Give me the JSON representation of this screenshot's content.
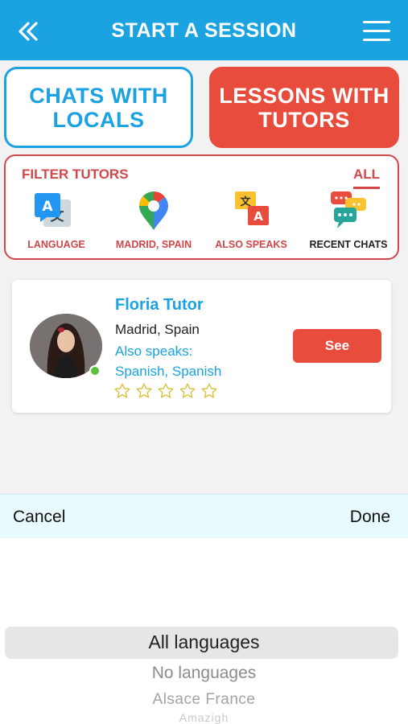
{
  "header": {
    "title": "START A SESSION",
    "back_icon": "double-chevron-left-icon",
    "menu_icon": "hamburger-menu-icon",
    "color": "#1aa3e0"
  },
  "choices": {
    "locals_label": "CHATS WITH LOCALS",
    "tutors_label": "LESSONS WITH TUTORS",
    "locals_color": "#1aa3e0",
    "tutors_color": "#e84c3d"
  },
  "filter": {
    "title": "FILTER TUTORS",
    "all_label": "ALL",
    "accent": "#d1474a",
    "items": [
      {
        "icon": "translate-icon",
        "label": "LANGUAGE"
      },
      {
        "icon": "map-pin-icon",
        "label": "MADRID, SPAIN"
      },
      {
        "icon": "translate-bubbles-icon",
        "label": "ALSO SPEAKS"
      },
      {
        "icon": "chat-bubbles-icon",
        "label": "RECENT CHATS"
      }
    ]
  },
  "tutor": {
    "name": "Floria Tutor",
    "location": "Madrid, Spain",
    "also_speaks_label": "Also speaks:",
    "languages": "Spanish, Spanish",
    "rating_stars": 0,
    "max_stars": 5,
    "online": true,
    "see_label": "See"
  },
  "picker": {
    "cancel_label": "Cancel",
    "done_label": "Done",
    "options": [
      "All languages",
      "No languages",
      "Alsace France",
      "Amazigh"
    ],
    "selected": "All languages"
  }
}
